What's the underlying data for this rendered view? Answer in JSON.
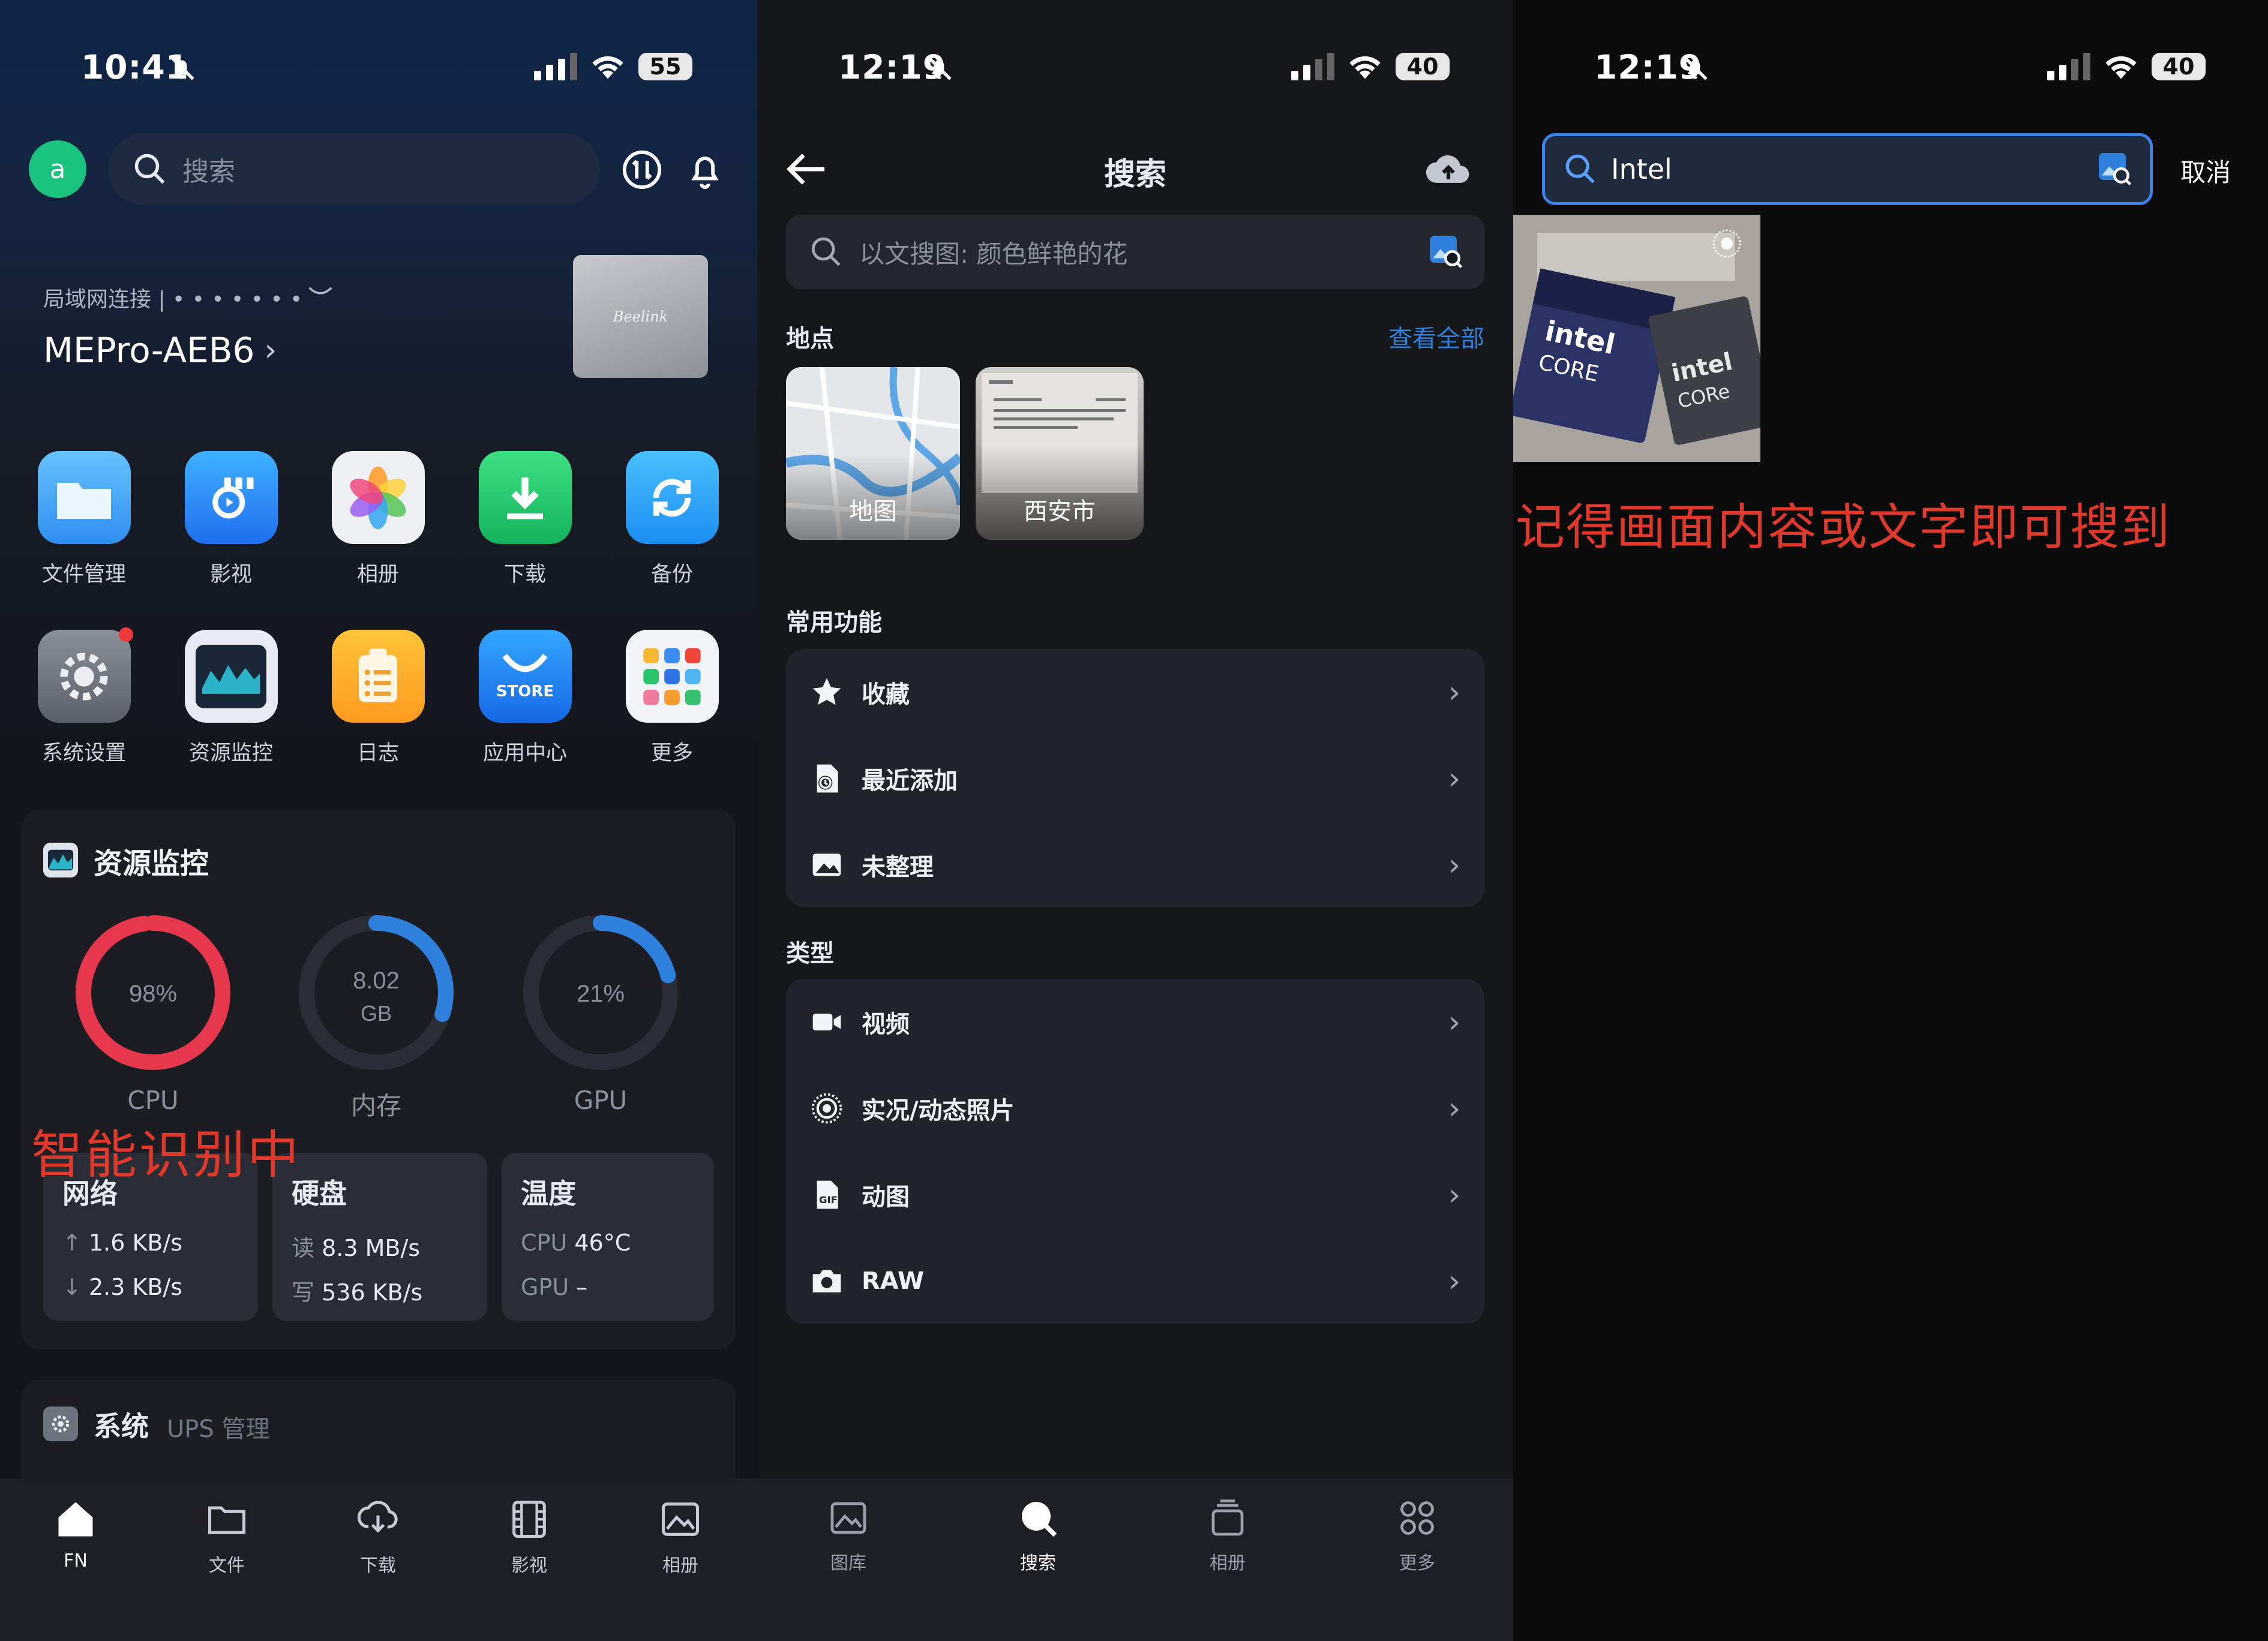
{
  "colors": {
    "accent": "#2f7fdc",
    "cpu_ring": "#e7374d",
    "annotation": "#e0392c",
    "green_avatar": "#19c37d"
  },
  "panel1": {
    "status": {
      "time": "10:41",
      "battery": "55"
    },
    "avatar": "a",
    "search_placeholder": "搜索",
    "connection": "局域网连接 | • • • • • • •",
    "device": "MEPro-AEB6",
    "device_brand": "Beelink",
    "apps": [
      {
        "label": "文件管理",
        "icon": "folder-icon"
      },
      {
        "label": "影视",
        "icon": "video-app-icon"
      },
      {
        "label": "相册",
        "icon": "photos-icon"
      },
      {
        "label": "下载",
        "icon": "download-icon"
      },
      {
        "label": "备份",
        "icon": "backup-icon"
      },
      {
        "label": "系统设置",
        "icon": "settings-icon"
      },
      {
        "label": "资源监控",
        "icon": "monitor-icon"
      },
      {
        "label": "日志",
        "icon": "log-icon"
      },
      {
        "label": "应用中心",
        "icon": "store-icon"
      },
      {
        "label": "更多",
        "icon": "more-apps-icon"
      }
    ],
    "store_text": "STORE",
    "monitor": {
      "title": "资源监控",
      "cpu": {
        "value": "98%",
        "label": "CPU",
        "fraction": 0.98
      },
      "mem": {
        "value": "8.02",
        "unit": "GB",
        "label": "内存",
        "fraction": 0.3
      },
      "gpu": {
        "value": "21%",
        "label": "GPU",
        "fraction": 0.21
      },
      "annotation": "智能识别中",
      "network": {
        "title": "网络",
        "up": "1.6 KB/s",
        "down": "2.3 KB/s"
      },
      "disk": {
        "title": "硬盘",
        "read_label": "读",
        "read": "8.3 MB/s",
        "write_label": "写",
        "write": "536 KB/s"
      },
      "temp": {
        "title": "温度",
        "cpu_label": "CPU",
        "cpu": "46°C",
        "gpu_label": "GPU",
        "gpu": "–"
      }
    },
    "system": {
      "title": "系统",
      "sub": "UPS 管理"
    },
    "tabs": [
      {
        "label": "FN",
        "icon": "home-icon"
      },
      {
        "label": "文件",
        "icon": "folder-tab-icon"
      },
      {
        "label": "下载",
        "icon": "download-tab-icon"
      },
      {
        "label": "影视",
        "icon": "film-tab-icon"
      },
      {
        "label": "相册",
        "icon": "album-tab-icon"
      }
    ]
  },
  "panel2": {
    "status": {
      "time": "12:19",
      "battery": "40"
    },
    "title": "搜索",
    "search_placeholder": "以文搜图: 颜色鲜艳的花",
    "places_title": "地点",
    "view_all": "查看全部",
    "places": [
      {
        "label": "地图"
      },
      {
        "label": "西安市"
      }
    ],
    "common_title": "常用功能",
    "common": [
      {
        "label": "收藏",
        "icon": "star-icon"
      },
      {
        "label": "最近添加",
        "icon": "recent-icon"
      },
      {
        "label": "未整理",
        "icon": "unsorted-icon"
      }
    ],
    "types_title": "类型",
    "types": [
      {
        "label": "视频",
        "icon": "video-icon"
      },
      {
        "label": "实况/动态照片",
        "icon": "live-photo-icon"
      },
      {
        "label": "动图",
        "icon": "gif-icon"
      },
      {
        "label": "RAW",
        "icon": "camera-icon"
      }
    ],
    "tabs": [
      {
        "label": "图库",
        "icon": "gallery-tab-icon"
      },
      {
        "label": "搜索",
        "icon": "search-tab-icon"
      },
      {
        "label": "相册",
        "icon": "albums-tab-icon"
      },
      {
        "label": "更多",
        "icon": "more-tab-icon"
      }
    ]
  },
  "panel3": {
    "status": {
      "time": "12:19",
      "battery": "40"
    },
    "search_value": "Intel",
    "cancel": "取消",
    "result_brand": "intel",
    "result_sub": "CORE",
    "annotation": "记得画面内容或文字即可搜到"
  }
}
